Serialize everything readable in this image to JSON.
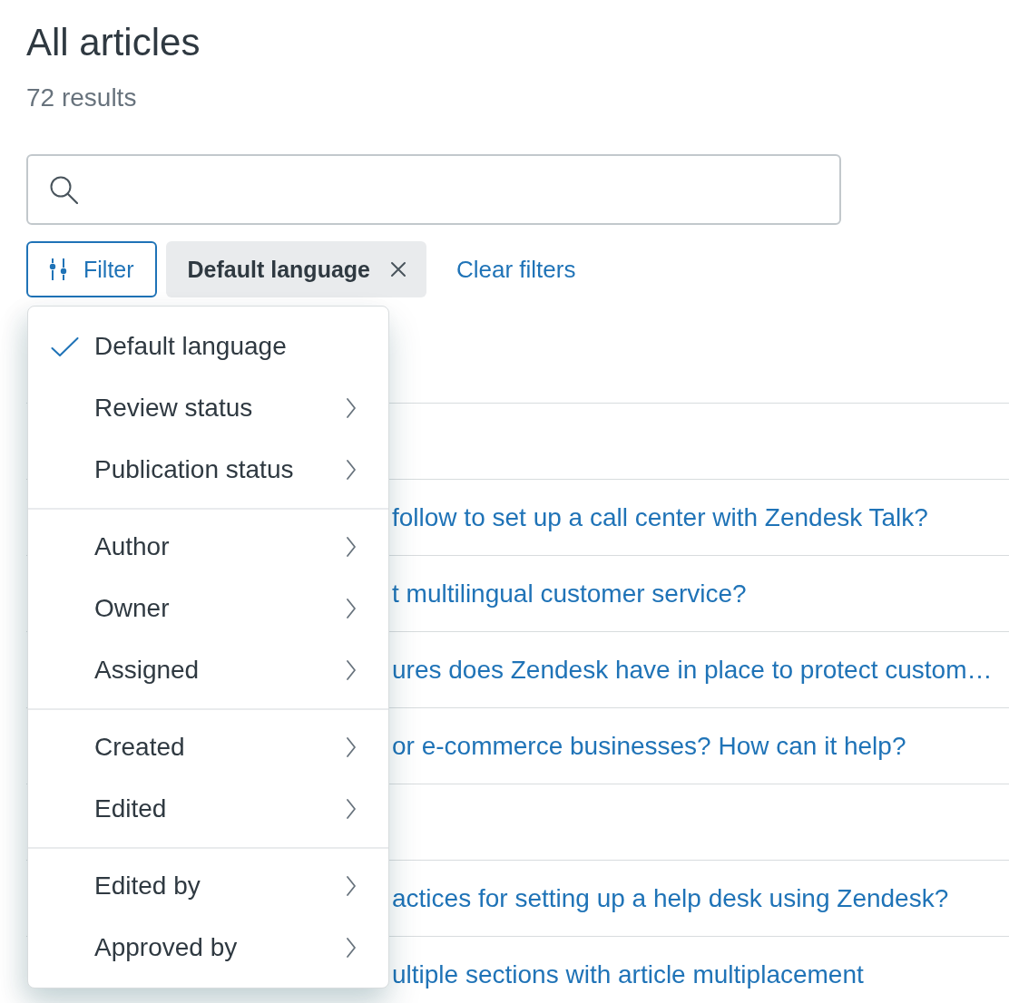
{
  "header": {
    "title": "All articles",
    "count": "72 results"
  },
  "filter_bar": {
    "filter_button": {
      "label": "Filter",
      "expanded": true
    },
    "chips": [
      {
        "label": "Default language"
      }
    ],
    "clear_link": "Clear filters"
  },
  "filter_menu": {
    "groups": [
      {
        "items": [
          {
            "label": "Default language",
            "checked": true,
            "submenu": false
          },
          {
            "label": "Review status",
            "checked": false,
            "submenu": true
          },
          {
            "label": "Publication status",
            "checked": false,
            "submenu": true
          }
        ]
      },
      {
        "items": [
          {
            "label": "Author",
            "checked": false,
            "submenu": true
          },
          {
            "label": "Owner",
            "checked": false,
            "submenu": true
          },
          {
            "label": "Assigned",
            "checked": false,
            "submenu": true
          }
        ]
      },
      {
        "items": [
          {
            "label": "Created",
            "checked": false,
            "submenu": true
          },
          {
            "label": "Edited",
            "checked": false,
            "submenu": true
          }
        ]
      },
      {
        "items": [
          {
            "label": "Edited by",
            "checked": false,
            "submenu": true
          },
          {
            "label": "Approved by",
            "checked": false,
            "submenu": true
          }
        ]
      }
    ]
  },
  "table": {
    "rows": [
      {
        "kind": "covered"
      },
      {
        "kind": "link",
        "title": "follow to set up a call center with Zendesk Talk?"
      },
      {
        "kind": "link",
        "title": "t multilingual customer service?"
      },
      {
        "kind": "link",
        "title": "ures does Zendesk have in place to protect custom…"
      },
      {
        "kind": "link",
        "title": "or e-commerce businesses? How can it help?"
      },
      {
        "kind": "covered"
      },
      {
        "kind": "link",
        "title": "actices for setting up a help desk using Zendesk?"
      },
      {
        "kind": "link",
        "title": "ultiple sections with article multiplacement"
      }
    ]
  }
}
